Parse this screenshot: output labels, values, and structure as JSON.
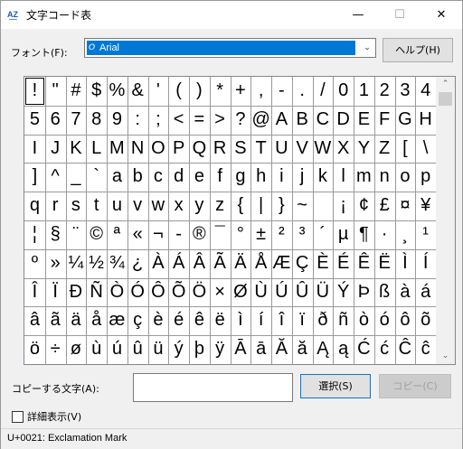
{
  "window": {
    "title": "文字コード表",
    "icon": "char-map-icon",
    "minimize": "—",
    "maximize": "☐",
    "close": "✕"
  },
  "font": {
    "label": "フォント(F):",
    "value": "Arial",
    "type_glyph": "O",
    "help_button": "ヘルプ(H)",
    "dropdown_glyph": "⌄"
  },
  "grid": {
    "rows": [
      [
        "!",
        "\"",
        "#",
        "$",
        "%",
        "&",
        "'",
        "(",
        ")",
        "*",
        "+",
        ",",
        "-",
        ".",
        "/",
        "0",
        "1",
        "2",
        "3",
        "4"
      ],
      [
        "5",
        "6",
        "7",
        "8",
        "9",
        ":",
        ";",
        "<",
        "=",
        ">",
        "?",
        "@",
        "A",
        "B",
        "C",
        "D",
        "E",
        "F",
        "G",
        "H"
      ],
      [
        "I",
        "J",
        "K",
        "L",
        "M",
        "N",
        "O",
        "P",
        "Q",
        "R",
        "S",
        "T",
        "U",
        "V",
        "W",
        "X",
        "Y",
        "Z",
        "[",
        "\\"
      ],
      [
        "]",
        "^",
        "_",
        "`",
        "a",
        "b",
        "c",
        "d",
        "e",
        "f",
        "g",
        "h",
        "i",
        "j",
        "k",
        "l",
        "m",
        "n",
        "o",
        "p"
      ],
      [
        "q",
        "r",
        "s",
        "t",
        "u",
        "v",
        "w",
        "x",
        "y",
        "z",
        "{",
        "|",
        "}",
        "~",
        " ",
        "¡",
        "¢",
        "£",
        "¤",
        "¥"
      ],
      [
        "¦",
        "§",
        "¨",
        "©",
        "ª",
        "«",
        "¬",
        "-",
        "®",
        "¯",
        "°",
        "±",
        "²",
        "³",
        "´",
        "µ",
        "¶",
        "·",
        "¸",
        "¹"
      ],
      [
        "º",
        "»",
        "¼",
        "½",
        "¾",
        "¿",
        "À",
        "Á",
        "Â",
        "Ã",
        "Ä",
        "Å",
        "Æ",
        "Ç",
        "È",
        "É",
        "Ê",
        "Ë",
        "Ì",
        "Í"
      ],
      [
        "Î",
        "Ï",
        "Ð",
        "Ñ",
        "Ò",
        "Ó",
        "Ô",
        "Õ",
        "Ö",
        "×",
        "Ø",
        "Ù",
        "Ú",
        "Û",
        "Ü",
        "Ý",
        "Þ",
        "ß",
        "à",
        "á"
      ],
      [
        "â",
        "ã",
        "ä",
        "å",
        "æ",
        "ç",
        "è",
        "é",
        "ê",
        "ë",
        "ì",
        "í",
        "î",
        "ï",
        "ð",
        "ñ",
        "ò",
        "ó",
        "ô",
        "õ"
      ],
      [
        "ö",
        "÷",
        "ø",
        "ù",
        "ú",
        "û",
        "ü",
        "ý",
        "þ",
        "ÿ",
        "Ā",
        "ā",
        "Ă",
        "ă",
        "Ą",
        "ą",
        "Ć",
        "ć",
        "Ĉ",
        "ĉ"
      ]
    ],
    "selected": "!",
    "scroll_up": "⌃",
    "scroll_down": "⌄"
  },
  "copy": {
    "label": "コピーする文字(A):",
    "value": "",
    "select_button": "選択(S)",
    "copy_button": "コピー(C)"
  },
  "details": {
    "label": "詳細表示(V)",
    "checked": false
  },
  "status": {
    "text": "U+0021: Exclamation Mark"
  }
}
